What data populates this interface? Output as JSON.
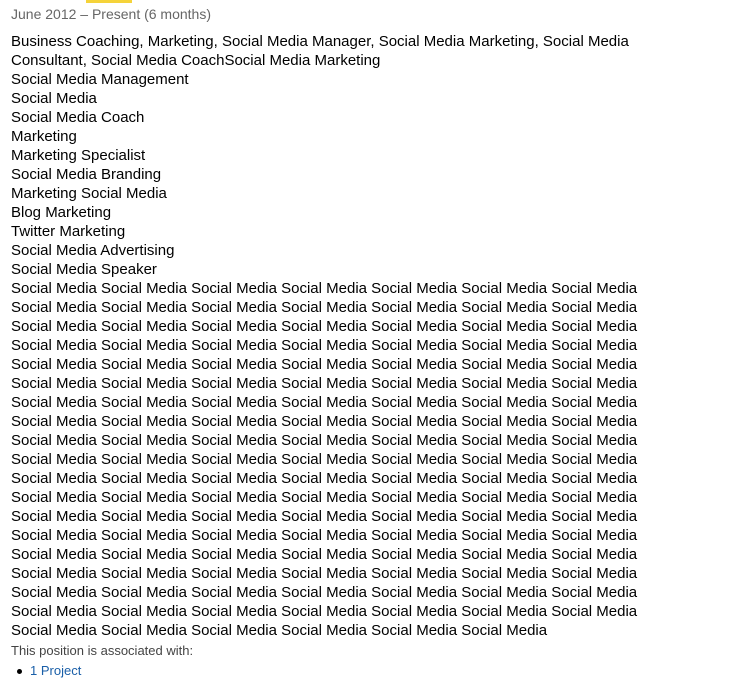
{
  "position": {
    "date_range": "June 2012 – Present (6 months)",
    "description_lines": [
      "Business Coaching, Marketing, Social Media Manager, Social Media Marketing, Social Media",
      "Consultant, Social Media CoachSocial Media Marketing",
      "Social Media Management",
      "Social Media",
      "Social Media Coach",
      "Marketing",
      "Marketing Specialist",
      "Social Media Branding",
      "Marketing Social Media",
      "Blog Marketing",
      "Twitter Marketing",
      "Social Media Advertising",
      "Social Media Speaker",
      "Social Media Social Media Social Media Social Media Social Media Social Media Social Media",
      "Social Media Social Media Social Media Social Media Social Media Social Media Social Media",
      "Social Media Social Media Social Media Social Media Social Media Social Media Social Media",
      "Social Media Social Media Social Media Social Media Social Media Social Media Social Media",
      "Social Media Social Media Social Media Social Media Social Media Social Media Social Media",
      "Social Media Social Media Social Media Social Media Social Media Social Media Social Media",
      "Social Media Social Media Social Media Social Media Social Media Social Media Social Media",
      "Social Media Social Media Social Media Social Media Social Media Social Media Social Media",
      "Social Media Social Media Social Media Social Media Social Media Social Media Social Media",
      "Social Media Social Media Social Media Social Media Social Media Social Media Social Media",
      "Social Media Social Media Social Media Social Media Social Media Social Media Social Media",
      "Social Media Social Media Social Media Social Media Social Media Social Media Social Media",
      "Social Media Social Media Social Media Social Media Social Media Social Media Social Media",
      "Social Media Social Media Social Media Social Media Social Media Social Media Social Media",
      "Social Media Social Media Social Media Social Media Social Media Social Media Social Media",
      "Social Media Social Media Social Media Social Media Social Media Social Media Social Media",
      "Social Media Social Media Social Media Social Media Social Media Social Media Social Media",
      "Social Media Social Media Social Media Social Media Social Media Social Media Social Media",
      "Social Media Social Media Social Media Social Media Social Media Social Media"
    ],
    "associated_label": "This position is associated with:",
    "associated_items": [
      {
        "label": "1 Project"
      }
    ]
  },
  "colors": {
    "accent_bar": "#f5d33a",
    "link": "#1a5fa8",
    "muted_text": "#666666"
  }
}
